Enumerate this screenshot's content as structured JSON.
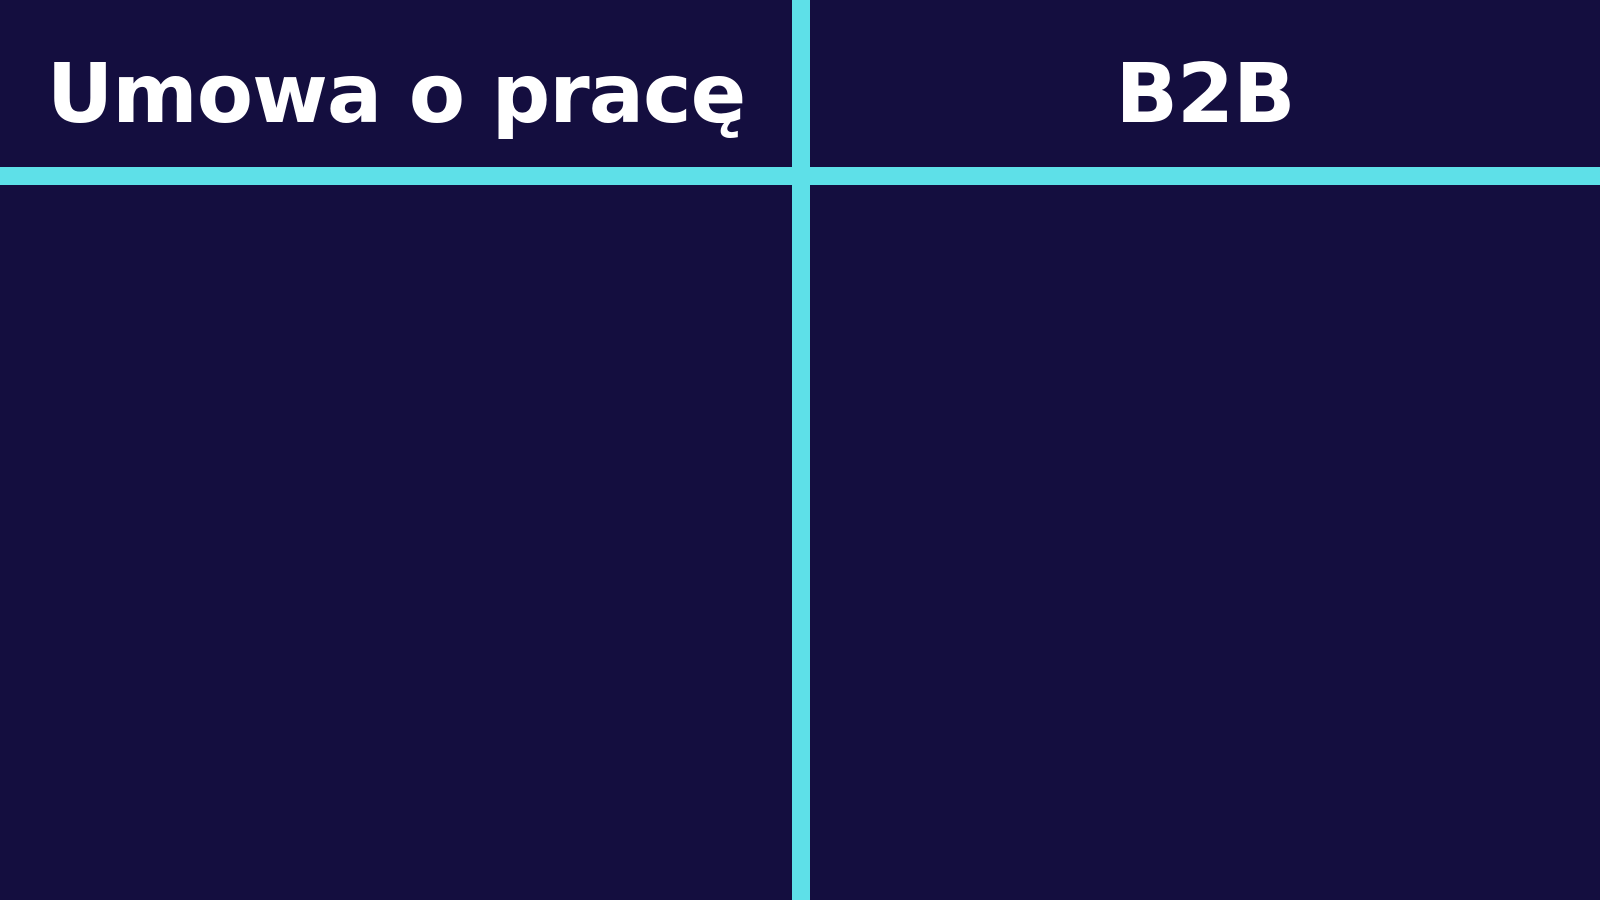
{
  "columns": {
    "left": {
      "heading": "Umowa o pracę"
    },
    "right": {
      "heading": "B2B"
    }
  },
  "colors": {
    "background": "#140e3f",
    "divider": "#5ee0e8",
    "heading_text": "#ffffff"
  }
}
